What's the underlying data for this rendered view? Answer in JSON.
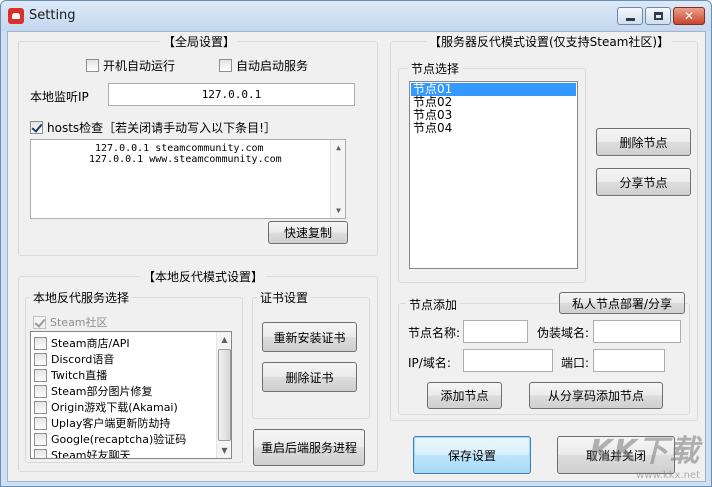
{
  "window": {
    "title": "Setting"
  },
  "global": {
    "title": "【全局设置】",
    "autostart_label": "开机自动运行",
    "autoservice_label": "自动启动服务",
    "listen_ip_label": "本地监听IP",
    "listen_ip_value": "127.0.0.1",
    "hosts_check_label": "hosts检查［若关闭请手动写入以下条目!］",
    "hosts_lines": [
      "127.0.0.1 steamcommunity.com",
      "127.0.0.1 www.steamcommunity.com"
    ],
    "copy_button": "快速复制"
  },
  "local_proxy": {
    "title": "【本地反代模式设置】",
    "service_select_label": "本地反代服务选择",
    "steam_community": "Steam社区",
    "services": [
      "Steam商店/API",
      "Discord语音",
      "Twitch直播",
      "Steam部分图片修复",
      "Origin游戏下载(Akamai)",
      "Uplay客户端更新防劫持",
      "Google(recaptcha)验证码",
      "Steam好友聊天"
    ],
    "cert_label": "证书设置",
    "reinstall_cert": "重新安装证书",
    "delete_cert": "删除证书",
    "restart_service": "重启后端服务进程"
  },
  "server_proxy": {
    "title": "【服务器反代模式设置(仅支持Steam社区)】",
    "node_select_label": "节点选择",
    "nodes": [
      "节点01",
      "节点02",
      "节点03",
      "节点04"
    ],
    "delete_node": "删除节点",
    "share_node": "分享节点",
    "node_add_label": "节点添加",
    "private_deploy": "私人节点部署/分享",
    "node_name_label": "节点名称:",
    "fake_domain_label": "伪装域名:",
    "ip_domain_label": "IP/域名:",
    "port_label": "端口:",
    "add_node": "添加节点",
    "add_from_code": "从分享码添加节点"
  },
  "footer": {
    "save": "保存设置",
    "cancel": "取消并关闭"
  },
  "watermark": {
    "logo": "KK下载",
    "url": "www.kkx.net"
  }
}
